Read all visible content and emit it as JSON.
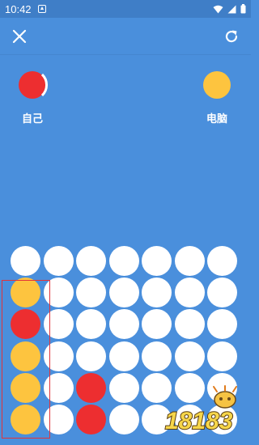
{
  "status_bar": {
    "time": "10:42"
  },
  "toolbar": {
    "close_icon": "close-icon",
    "restart_icon": "refresh-icon"
  },
  "players": [
    {
      "label": "自己",
      "color": "#ed2e30",
      "is_turn": true
    },
    {
      "label": "电脑",
      "color": "#fdc43f",
      "is_turn": false
    }
  ],
  "colors": {
    "background": "#4a8fdc",
    "empty": "#ffffff",
    "red": "#ed2e30",
    "yellow": "#fdc43f",
    "highlight": "#e2333a"
  },
  "board": {
    "columns": 7,
    "rows": 6,
    "grid": [
      [
        "E",
        "E",
        "E",
        "E",
        "E",
        "E",
        "E"
      ],
      [
        "Y",
        "E",
        "E",
        "E",
        "E",
        "E",
        "E"
      ],
      [
        "R",
        "E",
        "E",
        "E",
        "E",
        "E",
        "E"
      ],
      [
        "Y",
        "E",
        "E",
        "E",
        "E",
        "E",
        "E"
      ],
      [
        "Y",
        "E",
        "R",
        "E",
        "E",
        "E",
        "E"
      ],
      [
        "Y",
        "E",
        "R",
        "E",
        "E",
        "E",
        "E"
      ]
    ],
    "winning_column": 0
  },
  "watermark": {
    "text": "18183"
  }
}
